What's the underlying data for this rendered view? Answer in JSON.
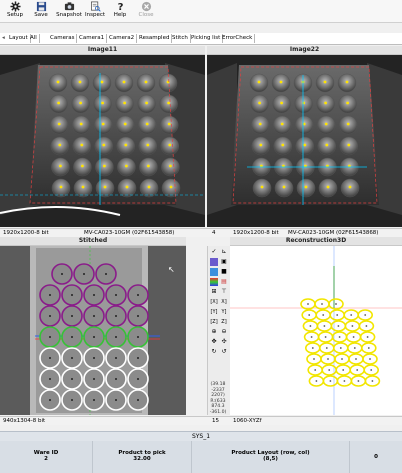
{
  "toolbar": {
    "setup": "Setup",
    "save": "Save",
    "snapshot": "Snapshot",
    "inspect": "Inspect",
    "help": "Help",
    "close": "Close"
  },
  "tabs": [
    "Layout",
    "All",
    "Cameras",
    "Camera1",
    "Camera2",
    "Resampled",
    "Stitch",
    "Picking list",
    "ErrorCheck"
  ],
  "panels": {
    "image11": "Image11",
    "image22": "Image22",
    "stitched": "Stitched",
    "reconstruction": "Reconstruction3D"
  },
  "status_top": {
    "left_res": "1920x1200-8 bit",
    "left_cam": "MV-CA023-10GM (02F61543858)",
    "mid_num": "4",
    "right_res": "1920x1200-8 bit",
    "right_cam": "MV-CA023-10GM (02F61543868)"
  },
  "status_bottom": {
    "left_res": "940x1304-8 bit",
    "mid_num": "15",
    "right_res": "1060-XYZf"
  },
  "coords_readout": "(39.18\n-2337\n2207)\nR:(633\n874.3\n-361.0)",
  "system": {
    "title": "SYS_1",
    "ware_id_label": "Ware ID",
    "ware_id_value": "2",
    "product_to_pick_label": "Product to pick",
    "product_to_pick_value": "32.00",
    "product_layout_label": "Product Layout (row, col)",
    "product_layout_value": "(8,5)",
    "last_value": "0"
  },
  "colors": {
    "accent_cyan": "#00c8ff",
    "purple_ring": "#8a1c8a",
    "green_ring": "#36c236",
    "white_ring": "#ffffff",
    "yellow_ring": "#f2e600",
    "detection_yellow": "#ffe400"
  },
  "icons": {
    "setup": "gear-icon",
    "save": "save-icon",
    "snapshot": "camera-icon",
    "inspect": "inspect-icon",
    "help": "help-icon",
    "close": "close-icon"
  }
}
